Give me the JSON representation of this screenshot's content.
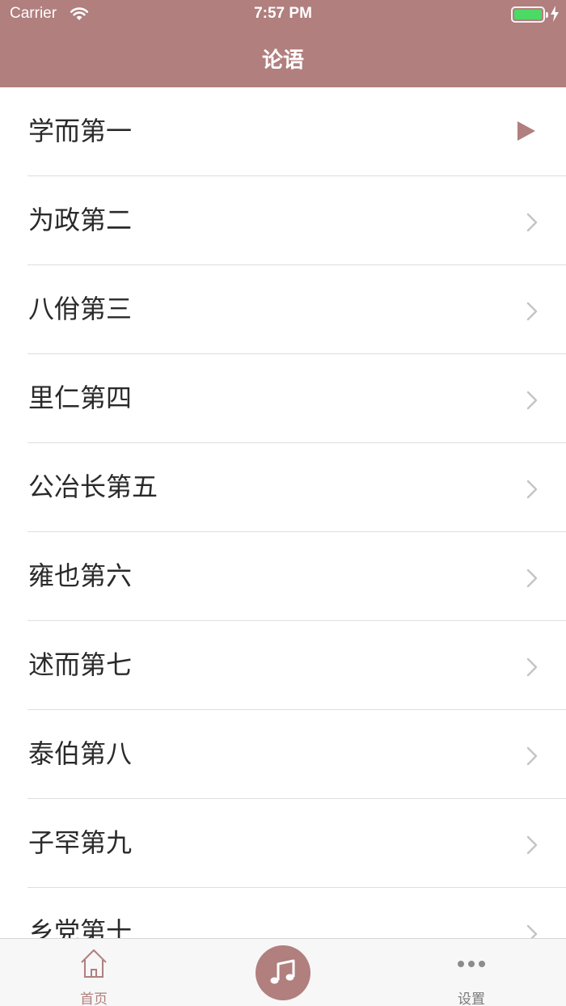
{
  "status_bar": {
    "carrier": "Carrier",
    "time": "7:57 PM",
    "battery_color": "#4cd964"
  },
  "nav": {
    "title": "论语",
    "bar_color": "#b07f7e"
  },
  "chapters": [
    {
      "label": "学而第一",
      "accessory": "play-icon"
    },
    {
      "label": "为政第二",
      "accessory": "chevron-right-icon"
    },
    {
      "label": "八佾第三",
      "accessory": "chevron-right-icon"
    },
    {
      "label": "里仁第四",
      "accessory": "chevron-right-icon"
    },
    {
      "label": "公冶长第五",
      "accessory": "chevron-right-icon"
    },
    {
      "label": "雍也第六",
      "accessory": "chevron-right-icon"
    },
    {
      "label": "述而第七",
      "accessory": "chevron-right-icon"
    },
    {
      "label": "泰伯第八",
      "accessory": "chevron-right-icon"
    },
    {
      "label": "子罕第九",
      "accessory": "chevron-right-icon"
    },
    {
      "label": "乡党第十",
      "accessory": "chevron-right-icon"
    }
  ],
  "tabbar": {
    "home": {
      "label": "首页",
      "icon": "home-icon"
    },
    "center": {
      "icon": "music-note-icon"
    },
    "settings": {
      "label": "设置",
      "icon": "more-icon"
    },
    "active_color": "#b07f7e"
  }
}
